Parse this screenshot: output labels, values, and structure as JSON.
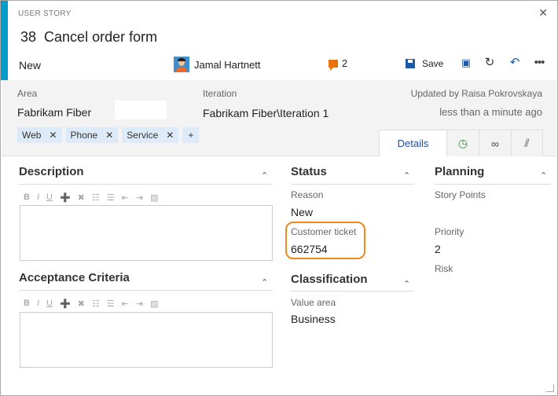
{
  "window": {
    "kind_label": "USER STORY",
    "close_icon": "close-icon"
  },
  "work_item": {
    "id": "38",
    "title": "Cancel order form",
    "state": "New",
    "assigned_to": "Jamal Hartnett",
    "comment_count": "2",
    "save_label": "Save"
  },
  "meta": {
    "area_label": "Area",
    "area_value": "Fabrikam Fiber",
    "iteration_label": "Iteration",
    "iteration_value": "Fabrikam Fiber\\Iteration 1",
    "updated_by": "Updated by Raisa Pokrovskaya",
    "updated_time": "less than a minute ago"
  },
  "tags": [
    {
      "label": "Web"
    },
    {
      "label": "Phone"
    },
    {
      "label": "Service"
    }
  ],
  "tags_add_label": "+",
  "tags_remove_glyph": "✕",
  "tabs": [
    {
      "label": "Details",
      "icon": "details"
    },
    {
      "label": "",
      "icon": "history-icon"
    },
    {
      "label": "",
      "icon": "link-icon"
    },
    {
      "label": "",
      "icon": "attachment-icon"
    }
  ],
  "sections": {
    "description": "Description",
    "acceptance": "Acceptance Criteria",
    "status": "Status",
    "classification": "Classification",
    "planning": "Planning"
  },
  "fields": {
    "reason_label": "Reason",
    "reason_value": "New",
    "customer_ticket_label": "Customer ticket",
    "customer_ticket_value": "662754",
    "value_area_label": "Value area",
    "value_area_value": "Business",
    "story_points_label": "Story Points",
    "priority_label": "Priority",
    "priority_value": "2",
    "risk_label": "Risk"
  },
  "editor_toolbar": [
    "B",
    "I",
    "U",
    "➕",
    "✖",
    "☷",
    "☰",
    "⇤",
    "⇥",
    "▨"
  ],
  "colors": {
    "accent": "#009ccc",
    "highlight": "#f08a1c",
    "comment": "#e8720c",
    "tag_bg": "#dcebf7",
    "tab_active_text": "#1f4fa0"
  }
}
